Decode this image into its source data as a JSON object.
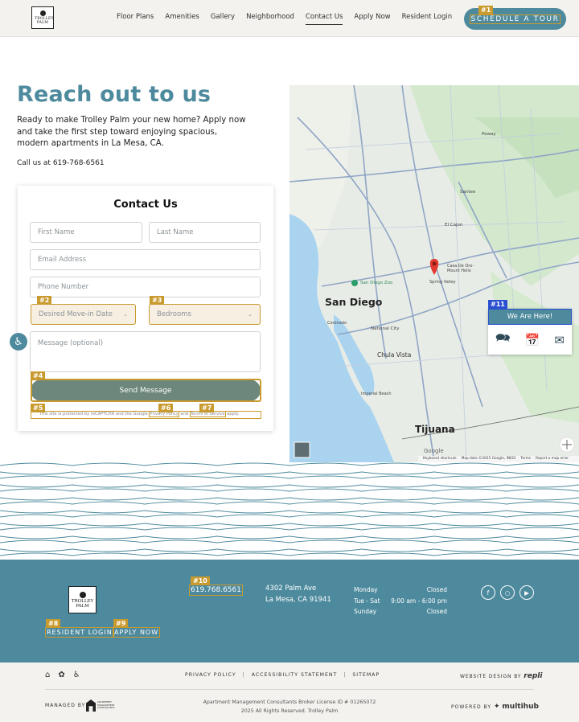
{
  "brand": {
    "logo_text": "TROLLEY PALM"
  },
  "nav": {
    "items": [
      "Floor Plans",
      "Amenities",
      "Gallery",
      "Neighborhood",
      "Contact Us",
      "Apply Now",
      "Resident Login"
    ],
    "active": "Contact Us"
  },
  "header": {
    "cta_label": "SCHEDULE A TOUR",
    "cta_badge": "#1"
  },
  "intro": {
    "heading": "Reach out to us",
    "body": "Ready to make Trolley Palm your new home? Apply now and take the first step toward enjoying spacious, modern apartments in La Mesa, CA.",
    "call": "Call us at 619-768-6561"
  },
  "form": {
    "title": "Contact Us",
    "first_name_placeholder": "First Name",
    "last_name_placeholder": "Last Name",
    "email_placeholder": "Email Address",
    "phone_placeholder": "Phone Number",
    "move_in_placeholder": "Desired Move-in Date",
    "bedrooms_placeholder": "Bedrooms",
    "message_placeholder": "Message (optional)",
    "submit_label": "Send Message",
    "recaptcha_prefix": "This site is protected by reCAPTCHA and the Google ",
    "privacy_link": "Privacy Policy",
    "recaptcha_and": " and ",
    "terms_link": "Terms of Service",
    "recaptcha_suffix": " apply.",
    "badges": {
      "move_in": "#2",
      "bedrooms": "#3",
      "submit": "#4",
      "recaptcha": "#5",
      "privacy": "#6",
      "terms": "#7"
    }
  },
  "map": {
    "labels": {
      "san_diego": "San Diego",
      "tijuana": "Tijuana",
      "chula_vista": "Chula Vista",
      "national_city": "National City",
      "el_cajon": "El Cajon",
      "santee": "Santee",
      "poway": "Poway",
      "la_mesa_pin": "Casa De Oro-Mount Helix",
      "spring_valley": "Spring Valley",
      "zoo": "San Diego Zoo",
      "coronado": "Coronado",
      "imperial_beach": "Imperial Beach",
      "google": "Google",
      "keyboard": "Keyboard shortcuts",
      "map_data": "Map data ©2025 Google, INEGI",
      "terms": "Terms",
      "report": "Report a map error"
    },
    "widget_title": "We Are Here!",
    "widget_badge": "#11"
  },
  "footer": {
    "logo_text": "TROLLEY PALM",
    "phone": "619.768.6561",
    "phone_badge": "#10",
    "address_line1": "4302 Palm Ave",
    "address_line2": "La Mesa, CA 91941",
    "hours": [
      {
        "day": "Monday",
        "time": "Closed"
      },
      {
        "day": "Tue - Sat",
        "time": "9:00 am - 6:00 pm"
      },
      {
        "day": "Sunday",
        "time": "Closed"
      }
    ],
    "resident_login": "RESIDENT LOGIN",
    "resident_badge": "#8",
    "apply_now": "APPLY NOW",
    "apply_badge": "#9",
    "social_icons": [
      "facebook-icon",
      "instagram-icon",
      "youtube-icon"
    ]
  },
  "bottom": {
    "privacy": "PRIVACY POLICY",
    "accessibility": "ACCESSIBILITY STATEMENT",
    "sitemap": "SITEMAP",
    "website_design_by": "WEBSITE DESIGN BY",
    "designer": "repli",
    "managed_by": "MANAGED BY",
    "manager_logo": "APARTMENT MANAGEMENT CONSULTANTS",
    "license": "Apartment Management Consultants Broker License ID # 01265072",
    "copyright": "2025 All Rights Reserved. Trolley Palm",
    "powered_by": "POWERED BY",
    "powered_name": "multihub"
  },
  "colors": {
    "accent": "#4e8a9d",
    "button": "#6d877c",
    "highlight": "#c99a2e",
    "badge_blue": "#2b4fd1"
  }
}
